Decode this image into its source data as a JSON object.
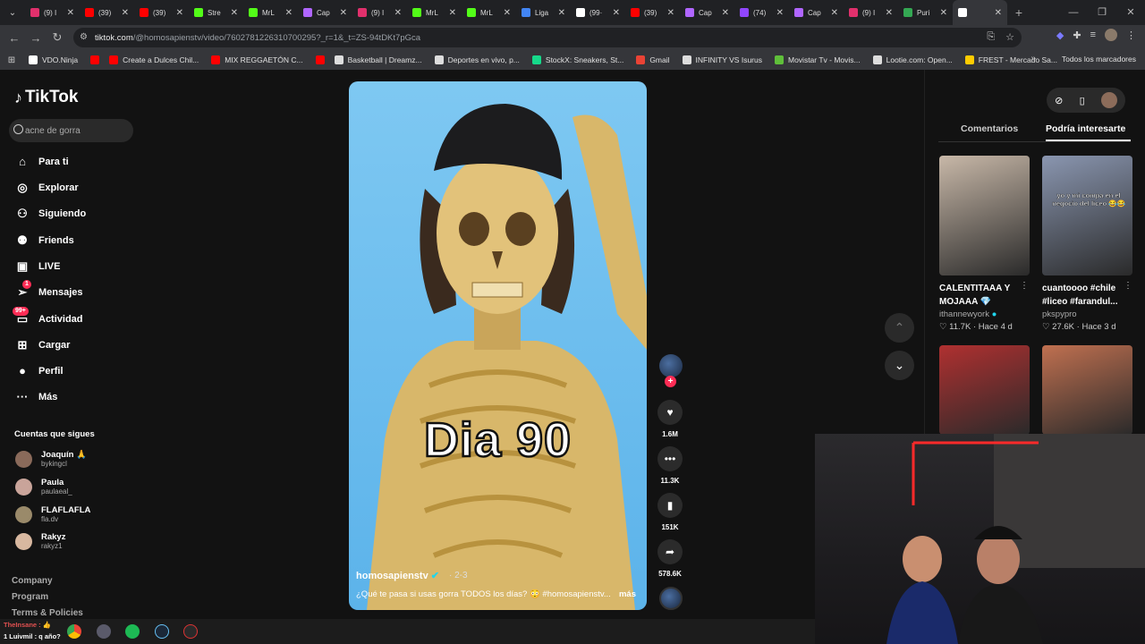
{
  "browser": {
    "tabs": [
      {
        "label": "(9) I",
        "color": "#e1306c"
      },
      {
        "label": "(39)",
        "color": "#ff0000"
      },
      {
        "label": "(39)",
        "color": "#ff0000"
      },
      {
        "label": "Stre",
        "color": "#53fc18"
      },
      {
        "label": "MrL",
        "color": "#53fc18"
      },
      {
        "label": "Cap",
        "color": "#b066ff"
      },
      {
        "label": "(9) I",
        "color": "#e1306c"
      },
      {
        "label": "MrL",
        "color": "#53fc18"
      },
      {
        "label": "MrL",
        "color": "#53fc18"
      },
      {
        "label": "Liga",
        "color": "#4285f4"
      },
      {
        "label": "(99·",
        "color": "#ffffff"
      },
      {
        "label": "(39)",
        "color": "#ff0000"
      },
      {
        "label": "Cap",
        "color": "#b066ff"
      },
      {
        "label": "(74)",
        "color": "#9146ff"
      },
      {
        "label": "Cap",
        "color": "#b066ff"
      },
      {
        "label": "(9) I",
        "color": "#e1306c"
      },
      {
        "label": "Puri",
        "color": "#34a853"
      },
      {
        "label": "",
        "color": "#ffffff"
      }
    ],
    "url_host": "tiktok.com",
    "url_path": "/@homosapienstv/video/7602781226310700295?_r=1&_t=ZS-94tDKt7pGca",
    "bookmarks": [
      {
        "label": "VDO.Ninja",
        "color": "#ffffff"
      },
      {
        "label": "",
        "color": "#ff0000"
      },
      {
        "label": "Create a Dulces Chil...",
        "color": "#ff0000"
      },
      {
        "label": "MIX REGGAETÓN C...",
        "color": "#ff0000"
      },
      {
        "label": "",
        "color": "#ff0000"
      },
      {
        "label": "Basketball | Dreamz...",
        "color": "#dddddd"
      },
      {
        "label": "Deportes en vivo, p...",
        "color": "#dddddd"
      },
      {
        "label": "StockX: Sneakers, St...",
        "color": "#16d98a"
      },
      {
        "label": "Gmail",
        "color": "#ea4335"
      },
      {
        "label": "INFINITY VS Isurus",
        "color": "#dddddd"
      },
      {
        "label": "Movistar Tv - Movis...",
        "color": "#5fbf3a"
      },
      {
        "label": "Lootie.com: Open...",
        "color": "#dddddd"
      },
      {
        "label": "FREST - Mercado Sa...",
        "color": "#ffcc00"
      }
    ],
    "all_bookmarks": "Todos los marcadores"
  },
  "sidebar": {
    "logo": "TikTok",
    "search_placeholder": "acne de gorra",
    "nav": [
      {
        "label": "Para ti",
        "icon": "⌂"
      },
      {
        "label": "Explorar",
        "icon": "◎"
      },
      {
        "label": "Siguiendo",
        "icon": "⚇"
      },
      {
        "label": "Friends",
        "icon": "⚉"
      },
      {
        "label": "LIVE",
        "icon": "▣"
      },
      {
        "label": "Mensajes",
        "icon": "➢",
        "badge": "1"
      },
      {
        "label": "Actividad",
        "icon": "▭",
        "badge": "99+"
      },
      {
        "label": "Cargar",
        "icon": "⊞"
      },
      {
        "label": "Perfil",
        "icon": "●"
      },
      {
        "label": "Más",
        "icon": "···"
      }
    ],
    "following_title": "Cuentas que sigues",
    "following": [
      {
        "name": "Joaquín 🙏",
        "user": "bykingcl",
        "color": "#8a6a5a"
      },
      {
        "name": "Paula",
        "user": "paulaeal_",
        "color": "#c9a49a"
      },
      {
        "name": "FLAFLAFLA",
        "user": "fla.dv",
        "color": "#9a8a6a"
      },
      {
        "name": "Rakyz",
        "user": "rakyz1",
        "color": "#d8b8a0"
      }
    ],
    "footer": [
      "Company",
      "Program",
      "Terms & Policies"
    ]
  },
  "video": {
    "overlay_text": "Dia 90",
    "username": "homosapienstv",
    "date": "· 2-3",
    "description": "¿Qué te pasa si usas gorra TODOS los días? 😳 #homosapienstv...",
    "more": "más"
  },
  "actions": {
    "likes": "1.6M",
    "comments": "11.3K",
    "saves": "151K",
    "shares": "578.6K"
  },
  "right_panel": {
    "tab_comments": "Comentarios",
    "tab_interest": "Podría interesarte",
    "videos": [
      {
        "title": "CALENTITAAA Y MOJAAA 💎",
        "user": "ithannewyork",
        "likes": "11.7K",
        "age": "Hace 4 d",
        "overlay": "",
        "bg": "#c8b8a8"
      },
      {
        "title": "cuantoooo #chile #liceo #farandul...",
        "user": "pkspypro",
        "likes": "27.6K",
        "age": "Hace 3 d",
        "overlay": "yo y mi compa en el negocio del liceo 😂😂",
        "bg": "#8a96b0"
      },
      {
        "title": "",
        "user": "",
        "likes": "",
        "age": "",
        "overlay": "",
        "bg": "#b03030"
      },
      {
        "title": "",
        "user": "",
        "likes": "",
        "age": "",
        "overlay": "",
        "bg": "#c07050"
      }
    ]
  },
  "stream_chat": [
    {
      "text": "TheInsane : 👍"
    },
    {
      "text": "1 Luivmil : q año?"
    }
  ]
}
